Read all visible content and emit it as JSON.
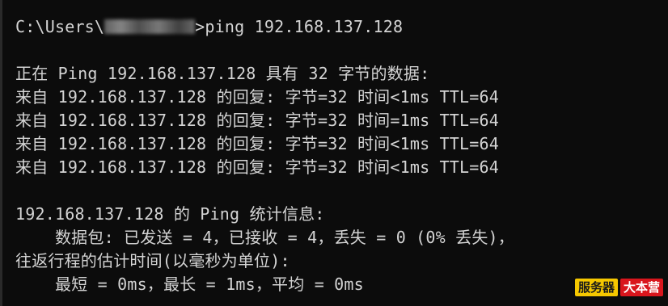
{
  "terminal": {
    "prompt": "C:\\Users\\",
    "command": ">ping 192.168.137.128",
    "ping_header": "正在 Ping 192.168.137.128 具有 32 字节的数据:",
    "replies": [
      "来自 192.168.137.128 的回复: 字节=32 时间<1ms TTL=64",
      "来自 192.168.137.128 的回复: 字节=32 时间=1ms TTL=64",
      "来自 192.168.137.128 的回复: 字节=32 时间<1ms TTL=64",
      "来自 192.168.137.128 的回复: 字节=32 时间<1ms TTL=64"
    ],
    "stats_header": "192.168.137.128 的 Ping 统计信息:",
    "packets": "    数据包: 已发送 = 4，已接收 = 4，丢失 = 0 (0% 丢失)，",
    "rtt_header": "往返行程的估计时间(以毫秒为单位):",
    "rtt_values": "    最短 = 0ms，最长 = 1ms，平均 = 0ms"
  },
  "watermark": {
    "part1": "服务器",
    "part2": "大本营"
  },
  "colors": {
    "background": "#0c0c0c",
    "text": "#d4d4d4",
    "watermark_yellow": "#f6c800",
    "watermark_red": "#d9161d"
  }
}
